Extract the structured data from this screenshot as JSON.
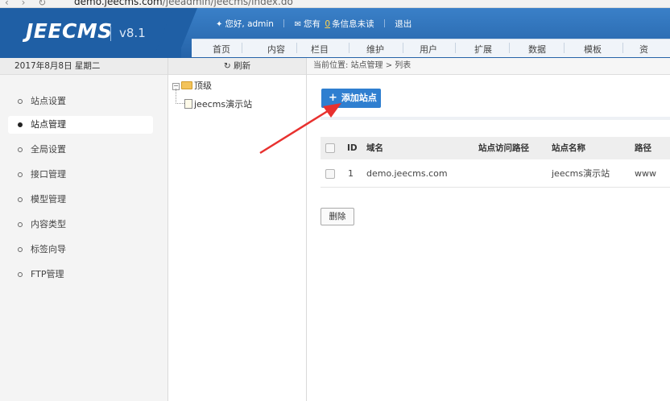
{
  "browser": {
    "nav_buttons": "‹ › ↻",
    "url_host": "demo.jeecms.com",
    "url_path": "/jeeadmin/jeecms/index.do"
  },
  "header": {
    "logo": "JEECMS",
    "version": "v8.1",
    "greeting": "您好, admin",
    "messages_prefix": "您有",
    "messages_count": "0",
    "messages_suffix": "条信息未读",
    "logout": "退出",
    "menu": [
      "首页",
      "内容",
      "栏目",
      "维护",
      "用户",
      "扩展",
      "数据",
      "模板",
      "资"
    ]
  },
  "leftnav": {
    "date": "2017年8月8日 星期二",
    "items": [
      {
        "label": "站点设置"
      },
      {
        "label": "站点管理"
      },
      {
        "label": "全局设置"
      },
      {
        "label": "接口管理"
      },
      {
        "label": "模型管理"
      },
      {
        "label": "内容类型"
      },
      {
        "label": "标签向导"
      },
      {
        "label": "FTP管理"
      }
    ],
    "active_index": 1
  },
  "tree": {
    "refresh": "刷新",
    "root": "顶级",
    "child": "jeecms演示站"
  },
  "main": {
    "breadcrumb": "当前位置: 站点管理 > 列表",
    "add_button": "添加站点",
    "columns": [
      "ID",
      "域名",
      "站点访问路径",
      "站点名称",
      "路径"
    ],
    "rows": [
      {
        "id": "1",
        "domain": "demo.jeecms.com",
        "access_path": "",
        "name": "jeecms演示站",
        "path": "www"
      }
    ],
    "delete_button": "删除"
  },
  "colors": {
    "header_blue": "#2a6fb7",
    "button_blue": "#2f7fd0",
    "arrow_red": "#e8312f"
  }
}
